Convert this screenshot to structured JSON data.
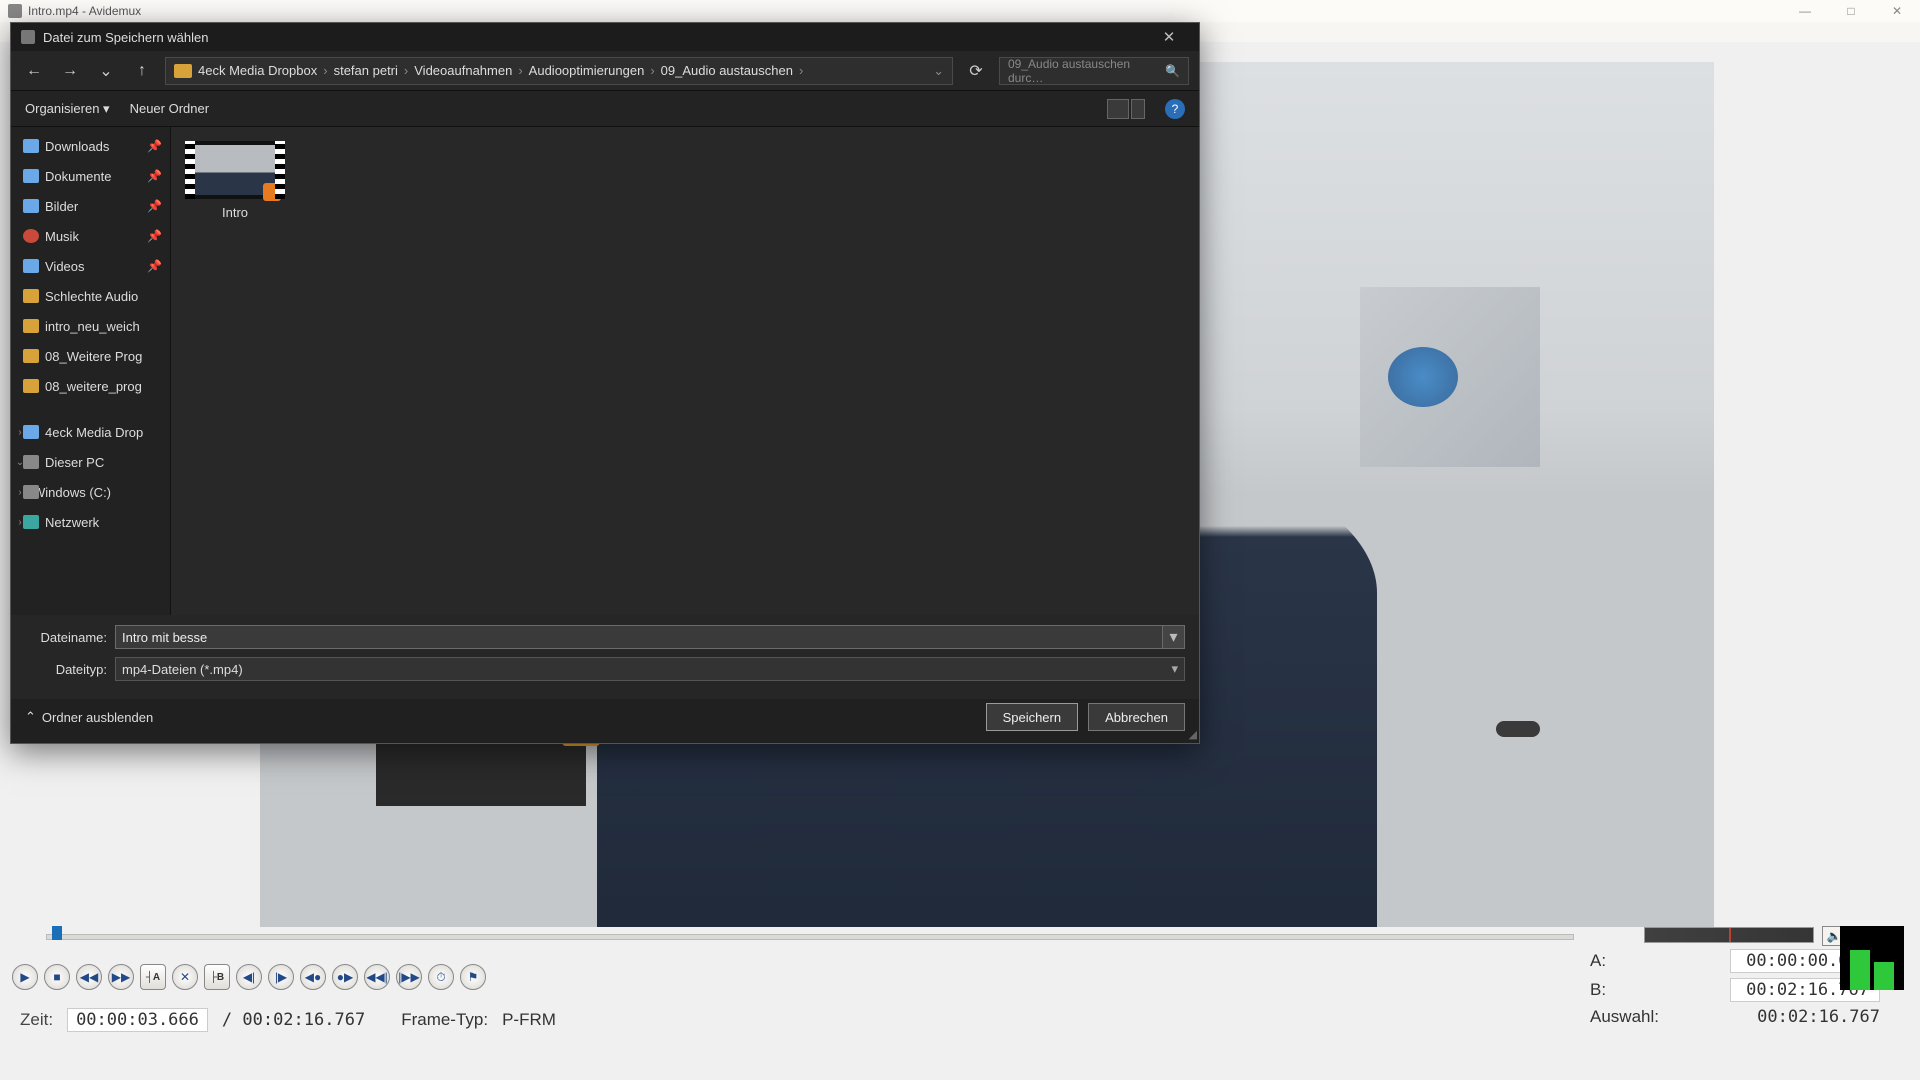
{
  "main_window": {
    "title": "Intro.mp4 - Avidemux",
    "minimize": "—",
    "maximize": "□",
    "close": "✕"
  },
  "timeline": {
    "speaker": "🔈"
  },
  "transport": {
    "play": "▶",
    "stop": "■",
    "prev_frame": "◀◀",
    "next_frame": "▶▶",
    "mark_a": "┤A",
    "delete": "✕",
    "mark_b": "├B",
    "prev_key": "◀|",
    "next_key": "|▶",
    "prev_cut": "◀●",
    "next_cut": "●▶",
    "prev_black": "◀◀|",
    "next_black": "|▶▶",
    "go_time": "⏱",
    "go_marker": "⚑"
  },
  "status": {
    "time_label": "Zeit:",
    "time_value": "00:00:03.666",
    "duration": "/ 00:02:16.767",
    "frame_type_label": "Frame-Typ:",
    "frame_type_value": "P-FRM"
  },
  "ab": {
    "a_label": "A:",
    "a_value": "00:00:00.000",
    "b_label": "B:",
    "b_value": "00:02:16.767",
    "sel_label": "Auswahl:",
    "sel_value": "00:02:16.767"
  },
  "dialog": {
    "title": "Datei zum Speichern wählen",
    "nav": {
      "back": "←",
      "forward": "→",
      "recent": "⌄",
      "up": "↑",
      "refresh": "⟳",
      "bc_dropdown": "⌄"
    },
    "breadcrumb": [
      "4eck Media Dropbox",
      "stefan petri",
      "Videoaufnahmen",
      "Audiooptimierungen",
      "09_Audio austauschen"
    ],
    "search_placeholder": "09_Audio austauschen durc…",
    "search_icon": "🔍",
    "toolbar": {
      "organize": "Organisieren ▾",
      "new_folder": "Neuer Ordner",
      "help": "?"
    },
    "sidebar": {
      "quick": [
        {
          "label": "Downloads",
          "cls": "",
          "pin": true
        },
        {
          "label": "Dokumente",
          "cls": "",
          "pin": true
        },
        {
          "label": "Bilder",
          "cls": "",
          "pin": true
        },
        {
          "label": "Musik",
          "cls": "music",
          "pin": true
        },
        {
          "label": "Videos",
          "cls": "",
          "pin": true
        },
        {
          "label": "Schlechte Audio",
          "cls": "folder",
          "pin": false
        },
        {
          "label": "intro_neu_weich",
          "cls": "folder",
          "pin": false
        },
        {
          "label": "08_Weitere Prog",
          "cls": "folder",
          "pin": false
        },
        {
          "label": "08_weitere_prog",
          "cls": "folder",
          "pin": false
        }
      ],
      "tree": [
        {
          "label": "4eck Media Drop",
          "cls": "",
          "exp": "›"
        },
        {
          "label": "Dieser PC",
          "cls": "drive",
          "exp": "⌄"
        },
        {
          "label": "Windows (C:)",
          "cls": "drive",
          "exp": "›",
          "indent": true
        },
        {
          "label": "Netzwerk",
          "cls": "net",
          "exp": "›"
        }
      ]
    },
    "files": [
      {
        "name": "Intro"
      }
    ],
    "filename_label": "Dateiname:",
    "filename_value": "Intro mit besse",
    "filetype_label": "Dateityp:",
    "filetype_value": "mp4-Dateien (*.mp4)",
    "hide_folders": "Ordner ausblenden",
    "hide_arrow": "⌃",
    "save": "Speichern",
    "cancel": "Abbrechen",
    "close": "✕"
  }
}
